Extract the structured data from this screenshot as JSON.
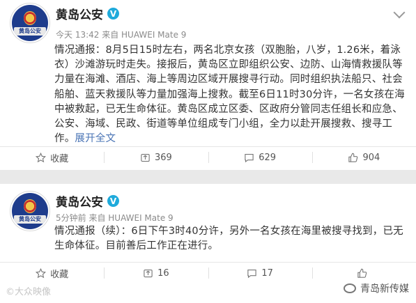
{
  "posts": [
    {
      "author": "黄岛公安",
      "avatar_text": "黄岛公安",
      "meta": "今天 13:42 来自 HUAWEI Mate 9",
      "content": "情况通报：8月5日15时左右，两名北京女孩（双胞胎，八岁，1.26米，着泳衣）沙滩游玩时走失。接报后，黄岛区立即组织公安、边防、山海情救援队等力量在海滩、酒店、海上等周边区域开展搜寻行动。同时组织执法船只、社会船舶、蓝天救援队等力量加强海上搜救。截至6日11时30分许，一名女孩在海中被救起，已无生命体征。黄岛区成立区委、区政府分管同志任组长和应急、公安、海域、民政、街道等单位组成专门小组，全力以赴开展搜救、搜寻工作。",
      "expand": "展开全文",
      "actions": {
        "favorite": "收藏",
        "repost": "369",
        "comment": "629",
        "like": "904"
      }
    },
    {
      "author": "黄岛公安",
      "avatar_text": "黄岛公安",
      "meta": "5分钟前 来自 HUAWEI Mate 9",
      "content": "情况通报（续）：6日下午3时40分许，另外一名女孩在海里被搜寻找到，已无生命体征。目前善后工作正在进行。",
      "actions": {
        "favorite": "收藏",
        "repost": "16",
        "comment": "17",
        "like": ""
      }
    }
  ],
  "watermark_left": "©大众映像",
  "watermark_right": "青岛新传媒",
  "colors": {
    "verified": "#1faadb",
    "expand_link": "#4a74b5",
    "gap": "#e9e9e9"
  }
}
